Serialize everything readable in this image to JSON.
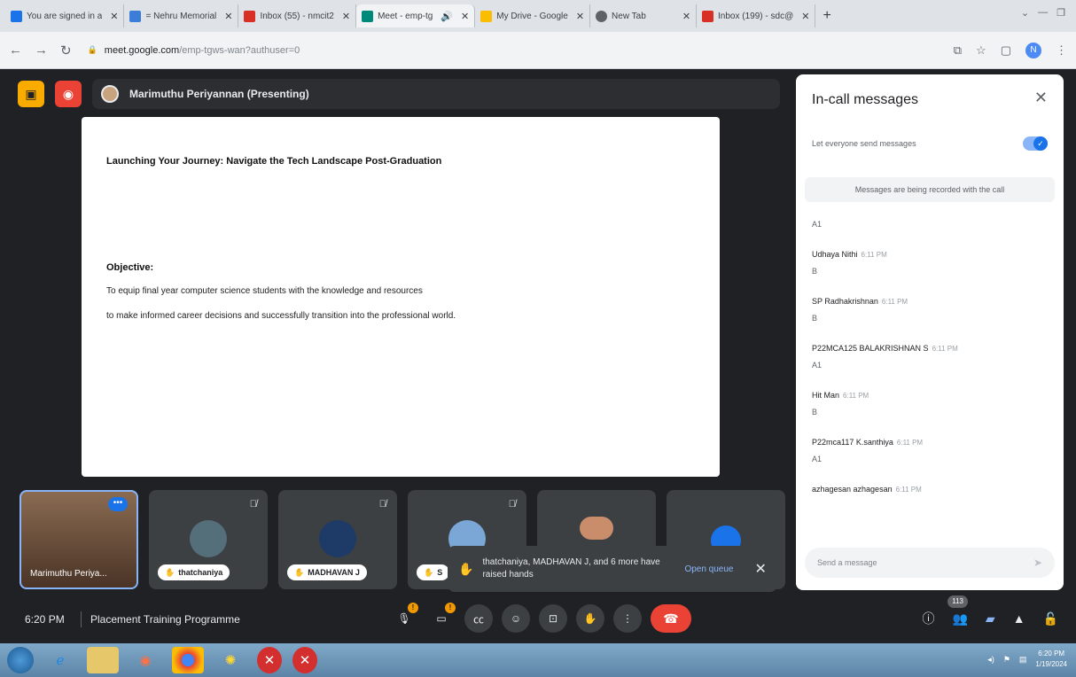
{
  "browser": {
    "tabs": [
      {
        "title": "You are signed in a",
        "favicon": "#1a73e8"
      },
      {
        "title": "= Nehru Memorial",
        "favicon": "#3b7dd8"
      },
      {
        "title": "Inbox (55) - nmcit2",
        "favicon": "#d93025"
      },
      {
        "title": "Meet - emp-tg",
        "favicon": "#00897b"
      },
      {
        "title": "My Drive - Google",
        "favicon": "#fbbc04"
      },
      {
        "title": "New Tab",
        "favicon": "#5f6368"
      },
      {
        "title": "Inbox (199) - sdc@",
        "favicon": "#d93025"
      }
    ],
    "url_host": "meet.google.com",
    "url_path": "/emp-tgws-wan?authuser=0",
    "profile_initial": "N"
  },
  "meet": {
    "presenter_label": "Marimuthu Periyannan (Presenting)",
    "slide": {
      "title": "Launching Your Journey: Navigate the Tech Landscape Post-Graduation",
      "objective_heading": "Objective:",
      "line1": "To equip final year computer science students with the knowledge and resources",
      "line2": "to make informed career decisions and successfully transition into the professional world."
    },
    "tiles": [
      {
        "name": "Marimuthu Periya..."
      },
      {
        "name": "thatchaniya"
      },
      {
        "name": "MADHAVAN J"
      },
      {
        "name": "S"
      }
    ],
    "toast": {
      "text": "thatchaniya, MADHAVAN J, and 6 more have raised hands",
      "action": "Open queue"
    },
    "time": "6:20 PM",
    "meeting_name": "Placement Training Programme",
    "participants_count": "113",
    "mic_badge": "!",
    "cam_badge": "!"
  },
  "chat": {
    "title": "In-call messages",
    "toggle_label": "Let everyone send messages",
    "toggle_on": true,
    "recorded_notice": "Messages are being recorded with the call",
    "first_text": "A1",
    "messages": [
      {
        "sender": "Udhaya Nithi",
        "time": "6:11 PM",
        "text": "B"
      },
      {
        "sender": "SP Radhakrishnan",
        "time": "6:11 PM",
        "text": "B"
      },
      {
        "sender": "P22MCA125 BALAKRISHNAN S",
        "time": "6:11 PM",
        "text": "A1"
      },
      {
        "sender": "Hit Man",
        "time": "6:11 PM",
        "text": "B"
      },
      {
        "sender": "P22mca117 K.santhiya",
        "time": "6:11 PM",
        "text": "A1"
      },
      {
        "sender": "azhagesan azhagesan",
        "time": "6:11 PM",
        "text": ""
      }
    ],
    "input_placeholder": "Send a message"
  },
  "taskbar": {
    "clock_time": "6:20 PM",
    "clock_date": "1/19/2024"
  }
}
